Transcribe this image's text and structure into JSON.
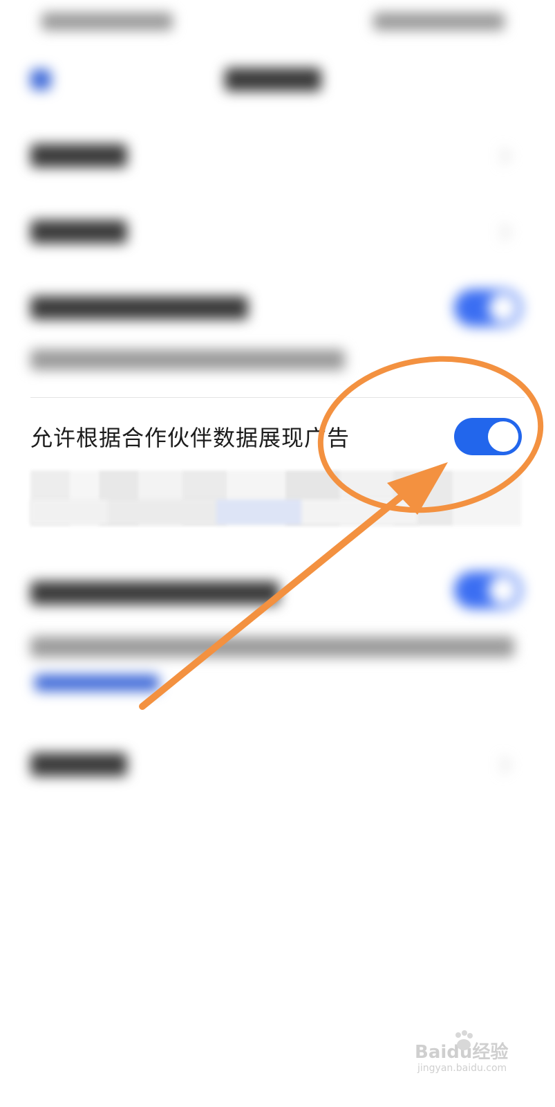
{
  "setting_row": {
    "label": "允许根据合作伙伴数据展现广告",
    "toggle_state": "on"
  },
  "colors": {
    "toggle_on": "#2266ec",
    "annotation": "#f39140"
  },
  "watermark": {
    "brand": "Baidu经验",
    "url": "jingyan.baidu.com"
  }
}
